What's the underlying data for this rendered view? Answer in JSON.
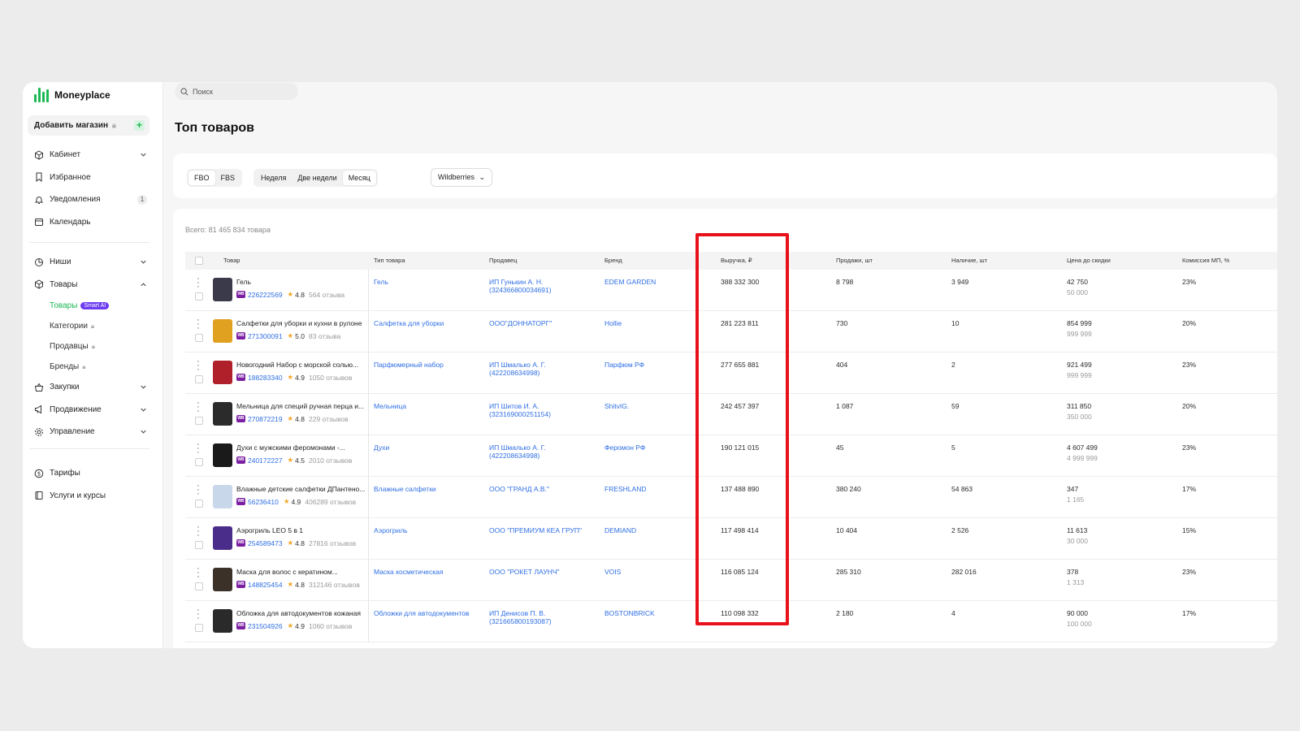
{
  "app": {
    "name": "Moneyplace"
  },
  "sidebar": {
    "add_shop_label": "Добавить магазин",
    "nav_top": [
      {
        "label": "Кабинет",
        "icon": "cube-icon",
        "chevron": "down"
      },
      {
        "label": "Избранное",
        "icon": "bookmark-icon"
      },
      {
        "label": "Уведомления",
        "icon": "bell-icon",
        "badge": "1"
      },
      {
        "label": "Календарь",
        "icon": "calendar-icon"
      }
    ],
    "nav_mid": [
      {
        "label": "Ниши",
        "icon": "pie-icon",
        "chevron": "down"
      },
      {
        "label": "Товары",
        "icon": "box-icon",
        "chevron": "up"
      }
    ],
    "goods_sub": [
      {
        "label": "Товары",
        "badge": "Smart AI",
        "active": true
      },
      {
        "label": "Категории",
        "locked": true
      },
      {
        "label": "Продавцы",
        "locked": true
      },
      {
        "label": "Бренды",
        "locked": true
      }
    ],
    "nav_low": [
      {
        "label": "Закупки",
        "icon": "basket-icon",
        "chevron": "down"
      },
      {
        "label": "Продвижение",
        "icon": "megaphone-icon",
        "chevron": "down"
      },
      {
        "label": "Управление",
        "icon": "settings-icon",
        "chevron": "down"
      }
    ],
    "nav_bottom": [
      {
        "label": "Тарифы",
        "icon": "dollar-icon"
      },
      {
        "label": "Услуги и курсы",
        "icon": "book-icon"
      }
    ]
  },
  "search": {
    "placeholder": "Поиск"
  },
  "page": {
    "title": "Топ товаров"
  },
  "filters": {
    "fulfillment": [
      "FBO",
      "FBS"
    ],
    "period": [
      "Неделя",
      "Две недели",
      "Месяц"
    ],
    "marketplace": "Wildberries"
  },
  "table": {
    "total_label": "Всего: 81 465 834 товара",
    "columns": [
      "Товар",
      "Тип товара",
      "Продавец",
      "Бренд",
      "Выручка, ₽",
      "Продажи, шт",
      "Наличие, шт",
      "Цена до скидки",
      "Комиссия МП, %"
    ],
    "rows": [
      {
        "name": "Гель",
        "sku": "226222569",
        "rating": "4.8",
        "reviews": "564 отзыва",
        "type": "Гель",
        "seller": "ИП Гунькин А. Н.",
        "seller_id": "(324366800034691)",
        "brand": "EDEM GARDEN",
        "revenue": "388 332 300",
        "sales": "8 798",
        "stock": "3 949",
        "price": "42 750",
        "price_old": "50 000",
        "commission": "23%",
        "thumb": "#3a3a4a"
      },
      {
        "name": "Салфетки для уборки и кухни в рулоне",
        "sku": "271300091",
        "rating": "5.0",
        "reviews": "83 отзыва",
        "type": "Салфетка для уборки",
        "seller": "ООО\"ДОННАТОРГ\"",
        "seller_id": "",
        "brand": "Hollie",
        "revenue": "281 223 811",
        "sales": "730",
        "stock": "10",
        "price": "854 999",
        "price_old": "999 999",
        "commission": "20%",
        "thumb": "#e0a020"
      },
      {
        "name": "Новогодний Набор с морской солью...",
        "sku": "188283340",
        "rating": "4.9",
        "reviews": "1050 отзывов",
        "type": "Парфюмерный набор",
        "seller": "ИП Шмалько А. Г.",
        "seller_id": "(422208634998)",
        "brand": "Парфюм РФ",
        "revenue": "277 655 881",
        "sales": "404",
        "stock": "2",
        "price": "921 499",
        "price_old": "999 999",
        "commission": "23%",
        "thumb": "#b0202a"
      },
      {
        "name": "Мельница для специй ручная перца и...",
        "sku": "270872219",
        "rating": "4.8",
        "reviews": "229 отзывов",
        "type": "Мельница",
        "seller": "ИП Шитов И. А.",
        "seller_id": "(323169000251154)",
        "brand": "ShitvIG.",
        "revenue": "242 457 397",
        "sales": "1 087",
        "stock": "59",
        "price": "311 850",
        "price_old": "350 000",
        "commission": "20%",
        "thumb": "#2b2b2b"
      },
      {
        "name": "Духи с мужскими феромонами -...",
        "sku": "240172227",
        "rating": "4.5",
        "reviews": "2010 отзывов",
        "type": "Духи",
        "seller": "ИП Шмалько А. Г.",
        "seller_id": "(422208634998)",
        "brand": "Феромон РФ",
        "revenue": "190 121 015",
        "sales": "45",
        "stock": "5",
        "price": "4 607 499",
        "price_old": "4 999 999",
        "commission": "23%",
        "thumb": "#1a1a1a"
      },
      {
        "name": "Влажные детские салфетки ДПантено...",
        "sku": "56236410",
        "rating": "4.9",
        "reviews": "406289 отзывов",
        "type": "Влажные салфетки",
        "seller": "ООО \"ГРАНД А.В.\"",
        "seller_id": "",
        "brand": "FRESHLAND",
        "revenue": "137 488 890",
        "sales": "380 240",
        "stock": "54 863",
        "price": "347",
        "price_old": "1 165",
        "commission": "17%",
        "thumb": "#c9d7ea"
      },
      {
        "name": "Аэрогриль LEO 5 в 1",
        "sku": "254589473",
        "rating": "4.8",
        "reviews": "27816 отзывов",
        "type": "Аэрогриль",
        "seller": "ООО \"ПРЕМИУМ КЕА ГРУП\"",
        "seller_id": "",
        "brand": "DEMIAND",
        "revenue": "117 498 414",
        "sales": "10 404",
        "stock": "2 526",
        "price": "11 613",
        "price_old": "30 000",
        "commission": "15%",
        "thumb": "#4a2c8a"
      },
      {
        "name": "Маска для волос с кератином...",
        "sku": "148825454",
        "rating": "4.8",
        "reviews": "312146 отзывов",
        "type": "Маска косметическая",
        "seller": "ООО \"РОКЕТ ЛАУНЧ\"",
        "seller_id": "",
        "brand": "VOIS",
        "revenue": "116 085 124",
        "sales": "285 310",
        "stock": "282 016",
        "price": "378",
        "price_old": "1 313",
        "commission": "23%",
        "thumb": "#3b3128"
      },
      {
        "name": "Обложка для автодокументов кожаная",
        "sku": "231504926",
        "rating": "4.9",
        "reviews": "1060 отзывов",
        "type": "Обложки для автодокументов",
        "seller": "ИП Денисов П. В.",
        "seller_id": "(321665800193087)",
        "brand": "BOSTONBRICK",
        "revenue": "110 098 332",
        "sales": "2 180",
        "stock": "4",
        "price": "90 000",
        "price_old": "100 000",
        "commission": "17%",
        "thumb": "#2a2a2a"
      }
    ]
  },
  "colors": {
    "accent": "#1db954",
    "link": "#2f6fe4",
    "highlight": "#e8111a",
    "wb_badge": "#7b1fa2",
    "smart_badge": "#6d3cf0"
  }
}
